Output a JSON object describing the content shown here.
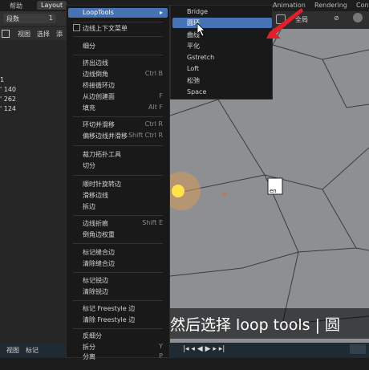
{
  "topbar": {
    "help": "帮助",
    "layout": "Layout",
    "animation": "Animation",
    "rendering": "Rendering",
    "compositing": "Con"
  },
  "left_panel": {
    "field_label": "段数",
    "field_value": "1",
    "view": "视图",
    "select": "选择",
    "add": "添",
    "numbers": [
      "1",
      "' 140",
      "' 262",
      "' 124"
    ]
  },
  "viewport": {
    "global": "全局"
  },
  "main_menu": {
    "items": [
      {
        "label": "LoopTools",
        "arrow": "▸"
      },
      {
        "label": "边线上下文菜单"
      },
      {
        "label": "细分"
      },
      {
        "label": "挤出边线"
      },
      {
        "label": "边线倒角",
        "shortcut": "Ctrl B"
      },
      {
        "label": "桥接循环边"
      },
      {
        "label": "从边创建面",
        "shortcut": "F"
      },
      {
        "label": "填充",
        "shortcut": "Alt F"
      },
      {
        "label": "环切并滑移",
        "shortcut": "Ctrl R"
      },
      {
        "label": "偏移边线并滑移",
        "shortcut": "Shift Ctrl R"
      },
      {
        "label": "裁刀拓扑工具"
      },
      {
        "label": "切分"
      },
      {
        "label": "顺时针旋转边"
      },
      {
        "label": "滑移边线"
      },
      {
        "label": "拆边"
      },
      {
        "label": "边线折痕",
        "shortcut": "Shift E"
      },
      {
        "label": "倒角边权重"
      },
      {
        "label": "标记缝合边"
      },
      {
        "label": "清除缝合边"
      },
      {
        "label": "标记锐边"
      },
      {
        "label": "清除锐边"
      },
      {
        "label": "标记 Freestyle 边"
      },
      {
        "label": "清除 Freestyle 边"
      },
      {
        "label": "反细分"
      },
      {
        "label": "拆分",
        "shortcut": "Y"
      },
      {
        "label": "分离",
        "shortcut": "P"
      }
    ]
  },
  "submenu": {
    "items": [
      "Bridge",
      "圆环",
      "曲线",
      "平化",
      "Gstretch",
      "Loft",
      "松弛",
      "Space"
    ]
  },
  "bottom": {
    "view": "视图",
    "marker": "标记"
  },
  "subtitle": "然后选择 loop tools | 圆",
  "colors": {
    "highlight": "#4772b3",
    "arrow": "#e0202a",
    "selected_vertex": "#ffe34a",
    "menu_bg": "#191919"
  }
}
